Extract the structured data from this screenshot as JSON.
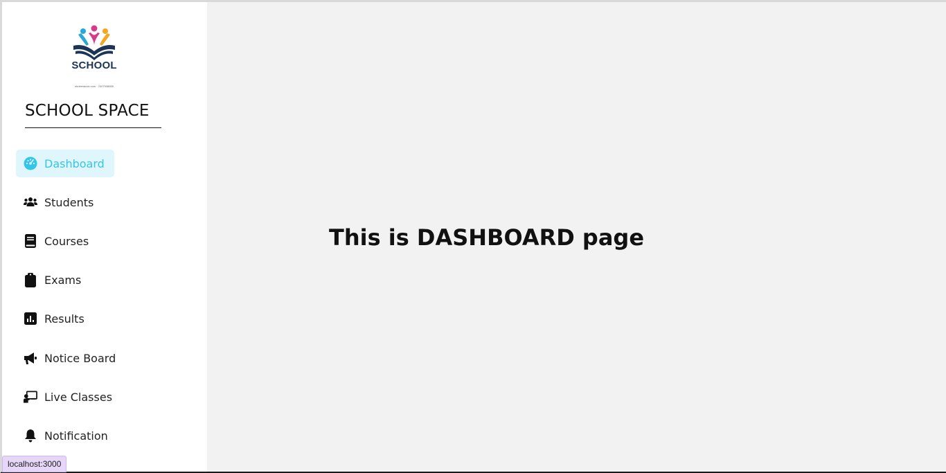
{
  "brand": {
    "logo_text": "SCHOOL",
    "logo_credit": "shutterstock.com · 2307938659",
    "name": "SCHOOL SPACE"
  },
  "sidebar": {
    "items": [
      {
        "label": "Dashboard",
        "icon": "dashboard-gauge-icon",
        "active": true
      },
      {
        "label": "Students",
        "icon": "users-group-icon",
        "active": false
      },
      {
        "label": "Courses",
        "icon": "book-icon",
        "active": false
      },
      {
        "label": "Exams",
        "icon": "clipboard-icon",
        "active": false
      },
      {
        "label": "Results",
        "icon": "bar-chart-icon",
        "active": false
      },
      {
        "label": "Notice Board",
        "icon": "megaphone-icon",
        "active": false
      },
      {
        "label": "Live Classes",
        "icon": "teacher-board-icon",
        "active": false
      },
      {
        "label": "Notification",
        "icon": "bell-icon",
        "active": false
      }
    ]
  },
  "main": {
    "heading": "This is DASHBOARD page"
  },
  "status_bar": {
    "url": "localhost:3000"
  },
  "colors": {
    "active_text": "#35c5e8",
    "active_bg": "#dff7fc",
    "main_bg": "#f2f2f2",
    "logo_navy": "#1c3557"
  }
}
